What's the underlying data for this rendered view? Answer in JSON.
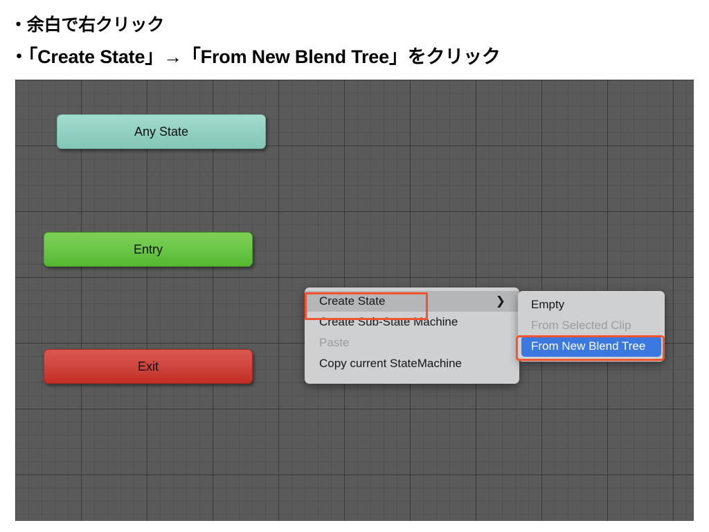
{
  "header": {
    "line1": "・余白で右クリック",
    "line2": "・「Create State」→「From New Blend Tree」をクリック"
  },
  "canvas": {
    "nodes": [
      {
        "label": "Any State",
        "type": "any-state",
        "color": "#93d2c4"
      },
      {
        "label": "Entry",
        "type": "entry",
        "color": "#6ec84a"
      },
      {
        "label": "Exit",
        "type": "exit",
        "color": "#cf4740"
      }
    ]
  },
  "context_menu": {
    "items": [
      {
        "label": "Create State",
        "state": "selected",
        "has_submenu": true
      },
      {
        "label": "Create Sub-State Machine",
        "state": "normal",
        "has_submenu": false
      },
      {
        "label": "Paste",
        "state": "disabled",
        "has_submenu": false
      },
      {
        "label": "Copy current StateMachine",
        "state": "normal",
        "has_submenu": false
      }
    ],
    "submenu_chevron": "❯"
  },
  "submenu": {
    "items": [
      {
        "label": "Empty",
        "state": "normal"
      },
      {
        "label": "From Selected Clip",
        "state": "disabled"
      },
      {
        "label": "From New Blend Tree",
        "state": "highlighted"
      }
    ]
  },
  "annotations": {
    "color": "#f25430",
    "targets": [
      "Create State",
      "From New Blend Tree"
    ]
  }
}
